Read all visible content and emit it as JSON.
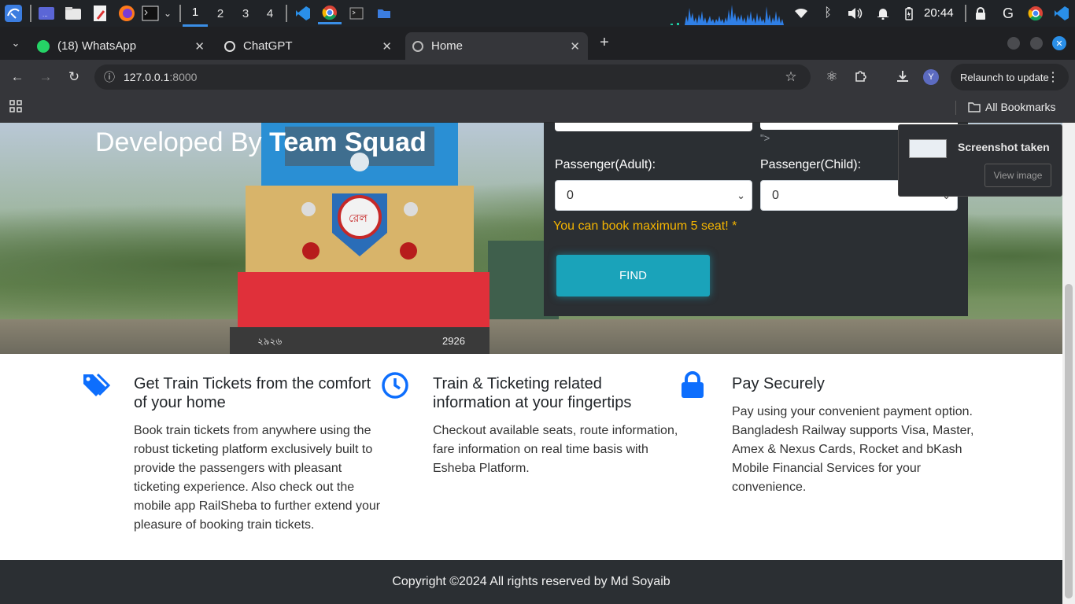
{
  "taskbar": {
    "workspaces": [
      "1",
      "2",
      "3",
      "4"
    ],
    "active_workspace": "1",
    "clock": "20:44"
  },
  "browser": {
    "tabs": [
      {
        "label": "(18) WhatsApp",
        "badge": "18",
        "active": false
      },
      {
        "label": "ChatGPT",
        "active": false
      },
      {
        "label": "Home",
        "active": true
      }
    ],
    "new_tab": "+",
    "url_host": "127.0.0.1",
    "url_port": ":8000",
    "profile_initial": "Y",
    "relaunch_label": "Relaunch to update",
    "bookmarks_label": "All Bookmarks"
  },
  "hero": {
    "developed_by": "Developed By",
    "team": "Team Squad",
    "loco_number": "2926",
    "loco_side_number": "২৯২৬"
  },
  "search_form": {
    "adult_label": "Passenger(Adult):",
    "adult_value": "0",
    "child_label": "Passenger(Child):",
    "child_value": "0",
    "stray_text": "\">",
    "notice": "You can book maximum 5 seat! *",
    "find_button": "FIND"
  },
  "features": [
    {
      "icon": "tags-icon",
      "title": "Get Train Tickets from the comfort of your home",
      "text": "Book train tickets from anywhere using the robust ticketing platform exclusively built to provide the passengers with pleasant ticketing experience. Also check out the mobile app RailSheba to further extend your pleasure of booking train tickets."
    },
    {
      "icon": "clock-icon",
      "title": "Train & Ticketing related information at your fingertips",
      "text": "Checkout available seats, route information, fare information on real time basis with Esheba Platform."
    },
    {
      "icon": "lock-icon",
      "title": "Pay Securely",
      "text": "Pay using your convenient payment option. Bangladesh Railway supports Visa, Master, Amex & Nexus Cards, Rocket and bKash Mobile Financial Services for your convenience."
    }
  ],
  "footer": {
    "copyright": "Copyright ©2024 All rights reserved by Md Soyaib"
  },
  "notification": {
    "title": "Screenshot taken",
    "button": "View image"
  },
  "colors": {
    "accent": "#1aa3ba",
    "feature_icon": "#0d6efd",
    "notice": "#f4b400",
    "panel": "#2b2f33"
  }
}
